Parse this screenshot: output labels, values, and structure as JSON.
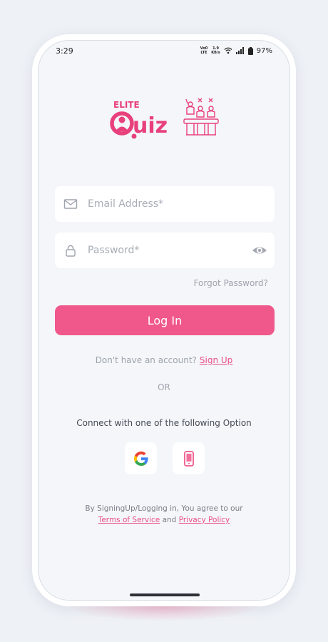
{
  "status_bar": {
    "time": "3:29",
    "volte_top": "Vo0",
    "volte_bottom": "LTE",
    "speed_top": "1.9",
    "speed_bottom": "KB/s",
    "battery": "97%"
  },
  "logo": {
    "elite": "ELITE",
    "quiz": "Quiz"
  },
  "form": {
    "email_placeholder": "Email Address*",
    "email_value": "",
    "password_placeholder": "Password*",
    "password_value": "",
    "forgot_label": "Forgot Password?",
    "login_label": "Log In"
  },
  "signup": {
    "prompt": "Don't have an account?",
    "link": "Sign Up"
  },
  "divider": "OR",
  "connect_label": "Connect with one of the following Option",
  "legal": {
    "prefix": "By SigningUp/Logging in, You agree to our",
    "terms": "Terms of Service",
    "and": "and",
    "privacy": "Privacy Policy"
  },
  "icons": {
    "email": "mail-icon",
    "password": "lock-icon",
    "reveal": "eye-icon",
    "google": "google-icon",
    "phone": "phone-icon"
  },
  "colors": {
    "accent": "#f0578a",
    "link": "#e84f84",
    "background": "#f4f6f9"
  }
}
